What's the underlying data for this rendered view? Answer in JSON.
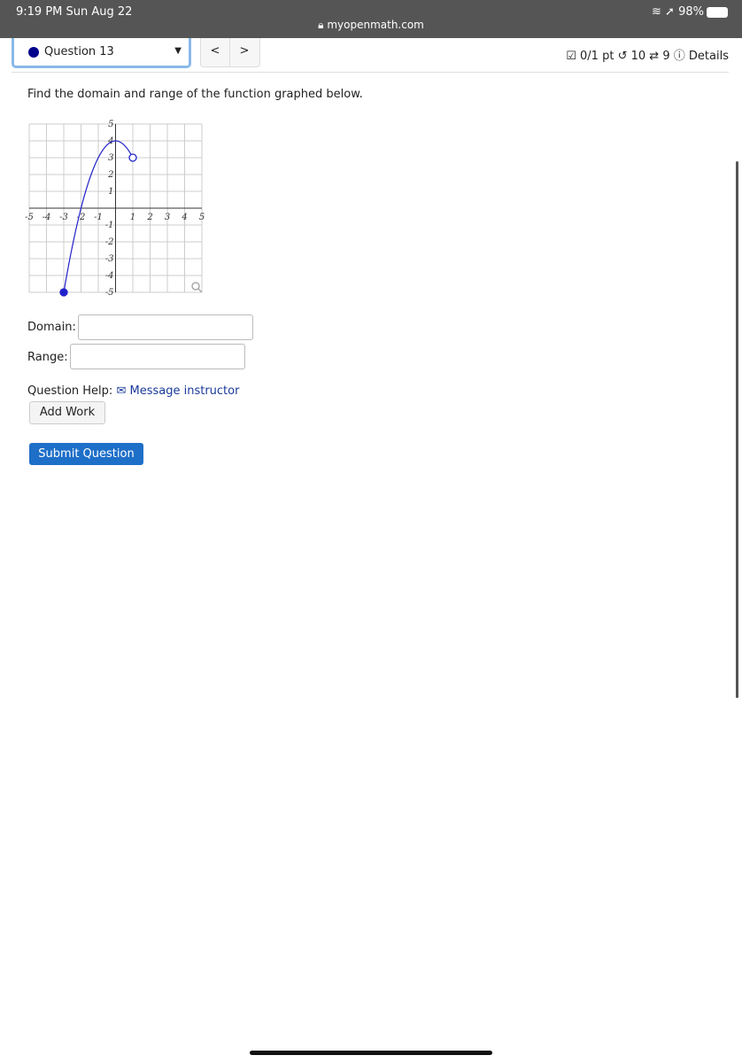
{
  "status_bar": {
    "time": "9:19 PM  Sun Aug 22",
    "url": "myopenmath.com",
    "battery": "98%"
  },
  "question_selector": {
    "label": "Question 13",
    "status_color": "#00008b"
  },
  "nav": {
    "prev": "<",
    "next": ">"
  },
  "score": {
    "points": "0/1 pt",
    "retries": "10",
    "attempts": "9",
    "details": "Details"
  },
  "prompt": "Find the domain and range of the function graphed below.",
  "chart_data": {
    "type": "line",
    "xlim": [
      -5,
      5
    ],
    "ylim": [
      -5,
      5
    ],
    "grid": true,
    "x_ticks": [
      "-5",
      "-4",
      "-3",
      "-2",
      "-1",
      "1",
      "2",
      "3",
      "4",
      "5"
    ],
    "y_ticks": [
      "5",
      "4",
      "3",
      "2",
      "1",
      "-1",
      "-2",
      "-3",
      "-4",
      "-5"
    ],
    "curve": "y = 4 - x^2",
    "x": [
      -3,
      -2.5,
      -2,
      -1.5,
      -1,
      -0.5,
      0,
      0.5,
      1
    ],
    "y": [
      -5,
      -2.25,
      0,
      1.75,
      3,
      3.75,
      4,
      3.75,
      3
    ],
    "endpoints": [
      {
        "x": -3,
        "y": -5,
        "type": "closed"
      },
      {
        "x": 1,
        "y": 3,
        "type": "open"
      }
    ],
    "color": "#2222cc"
  },
  "form": {
    "domain_label": "Domain:",
    "domain_value": "",
    "range_label": "Range:",
    "range_value": ""
  },
  "help": {
    "label": "Question Help:",
    "message": "Message instructor",
    "add_work": "Add Work"
  },
  "submit": "Submit Question"
}
